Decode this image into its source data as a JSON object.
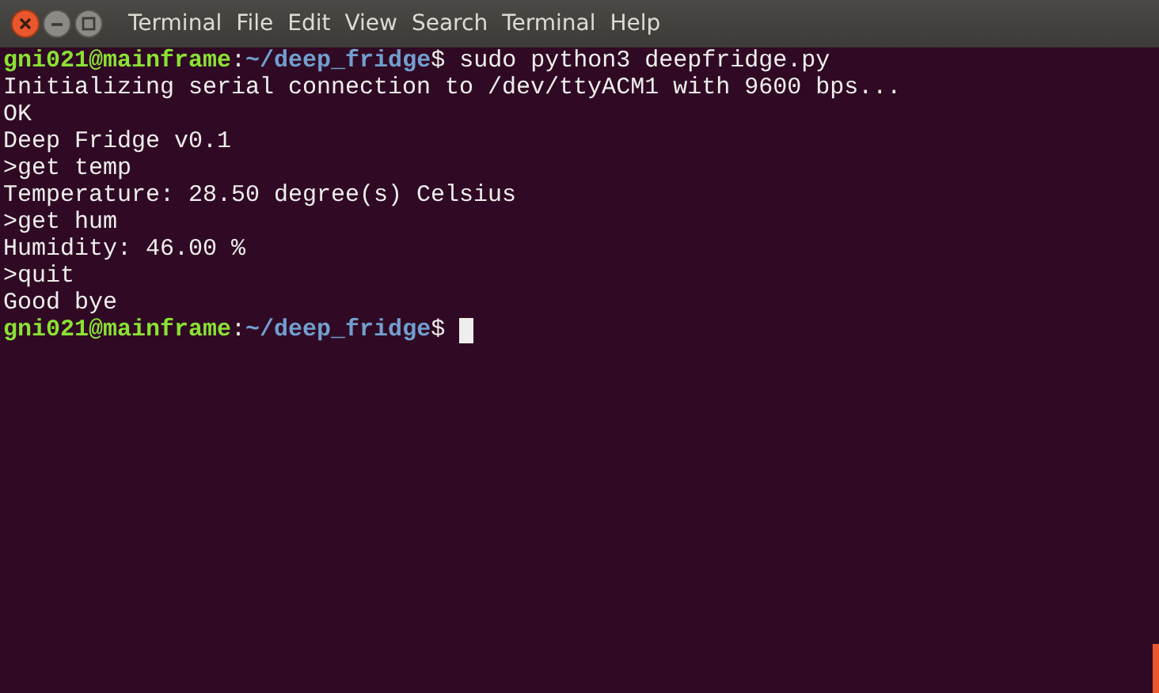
{
  "window": {
    "title": "Terminal"
  },
  "menu": [
    {
      "label": "File"
    },
    {
      "label": "Edit"
    },
    {
      "label": "View"
    },
    {
      "label": "Search"
    },
    {
      "label": "Terminal"
    },
    {
      "label": "Help"
    }
  ],
  "lines": [
    {
      "kind": "prompt",
      "user_host": "gni021@mainframe",
      "separator": ":",
      "path": "~/deep_fridge",
      "symbol": "$",
      "command": "sudo python3 deepfridge.py"
    },
    {
      "kind": "output",
      "text": "Initializing serial connection to /dev/ttyACM1 with 9600 bps..."
    },
    {
      "kind": "output",
      "text": "OK"
    },
    {
      "kind": "output",
      "text": "Deep Fridge v0.1"
    },
    {
      "kind": "output",
      "text": ">get temp"
    },
    {
      "kind": "output",
      "text": "Temperature: 28.50 degree(s) Celsius"
    },
    {
      "kind": "output",
      "text": ">get hum"
    },
    {
      "kind": "output",
      "text": "Humidity: 46.00 %"
    },
    {
      "kind": "output",
      "text": ">quit"
    },
    {
      "kind": "output",
      "text": "Good bye"
    },
    {
      "kind": "prompt",
      "user_host": "gni021@mainframe",
      "separator": ":",
      "path": "~/deep_fridge",
      "symbol": "$",
      "cursor": true
    }
  ]
}
